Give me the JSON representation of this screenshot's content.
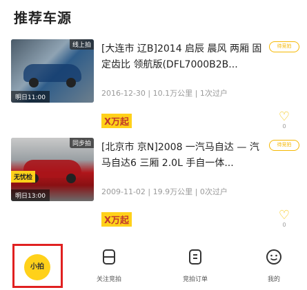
{
  "section": {
    "title": "推荐车源"
  },
  "cars": [
    {
      "thumb_badge": "线上拍",
      "thumb_time": "明日11:00",
      "title": "[大连市 辽B]2014 启辰 晨风 两厢 固定齿比 领航版(DFL7000B2B...",
      "tag": "待竞拍",
      "meta": "2016-12-30 | 10.1万公里 | 1次过户",
      "price": "X万起",
      "fav_count": "0",
      "has_yellow_tag": false
    },
    {
      "thumb_badge": "同步拍",
      "thumb_yellow_tag": "无忧检",
      "thumb_time": "明日13:00",
      "title": "[北京市 京N]2008 一汽马自达 — 汽马自达6 三厢 2.0L 手自一体...",
      "tag": "待竞拍",
      "meta": "2009-11-02 | 19.9万公里 | 0次过户",
      "price": "X万起",
      "fav_count": "0",
      "has_yellow_tag": true
    }
  ],
  "tabbar": {
    "home": "小拍",
    "follow": "关注竞拍",
    "orders": "竞拍订单",
    "mine": "我的"
  },
  "colors": {
    "accent": "#ffd11a",
    "highlight_border": "#e02020"
  }
}
